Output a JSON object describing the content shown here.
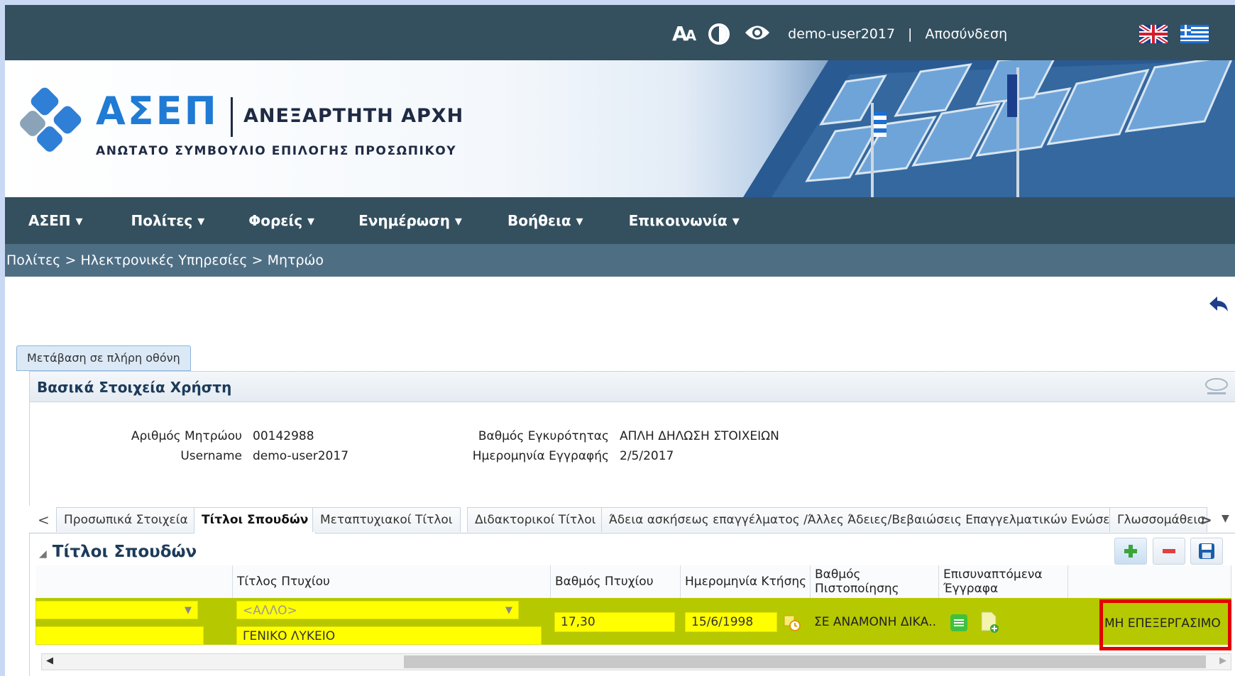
{
  "topbar": {
    "font_icon_big": "A",
    "font_icon_small": "A",
    "username": "demo-user2017",
    "separator": "|",
    "logout": "Αποσύνδεση"
  },
  "header": {
    "logo_title": "ΑΣΕΠ",
    "logo_authority": "ΑΝΕΞΑΡΤΗΤΗ ΑΡΧΗ",
    "logo_subtitle": "ΑΝΩΤΑΤΟ ΣΥΜΒΟΥΛΙΟ ΕΠΙΛΟΓΗΣ ΠΡΟΣΩΠΙΚΟΥ"
  },
  "nav": {
    "items": [
      {
        "label": "ΑΣΕΠ ▾"
      },
      {
        "label": "Πολίτες ▾"
      },
      {
        "label": "Φορείς ▾"
      },
      {
        "label": "Ενημέρωση ▾"
      },
      {
        "label": "Βοήθεια ▾"
      },
      {
        "label": "Επικοινωνία ▾"
      }
    ]
  },
  "breadcrumb": "Πολίτες > Ηλεκτρονικές Υπηρεσίες > Μητρώο",
  "fullscreen_button": "Μετάβαση σε πλήρη οθόνη",
  "user_panel": {
    "title": "Βασικά Στοιχεία Χρήστη",
    "registry_label": "Αριθμός Μητρώου",
    "registry_value": "00142988",
    "username_label": "Username",
    "username_value": "demo-user2017",
    "validity_label": "Βαθμός Εγκυρότητας",
    "validity_value": "ΑΠΛΗ ΔΗΛΩΣΗ ΣΤΟΙΧΕΙΩΝ",
    "regdate_label": "Ημερομηνία Εγγραφής",
    "regdate_value": "2/5/2017"
  },
  "tabs": {
    "items": [
      {
        "label": "Προσωπικά Στοιχεία"
      },
      {
        "label": "Τίτλοι Σπουδών"
      },
      {
        "label": "Μεταπτυχιακοί Τίτλοι"
      },
      {
        "label": "Διδακτορικοί Τίτλοι"
      },
      {
        "label": "Άδεια ασκήσεως επαγγέλματος /Άλλες Άδειες/Βεβαιώσεις Επαγγελματικών Ενώσεων"
      },
      {
        "label": "Γλωσσομάθεια"
      }
    ],
    "prev": "<",
    "next": ">",
    "menu": "▼"
  },
  "grid": {
    "title": "Τίτλοι Σπουδών",
    "collapse_icon": "◢",
    "headers": {
      "col0": "",
      "title": "Τίτλος Πτυχίου",
      "grade": "Βαθμός Πτυχίου",
      "date": "Ημερομηνία Κτήσης",
      "cert": "Βαθμός Πιστοποίησης",
      "attachments": "Επισυναπτόμενα Έγγραφα",
      "status": ""
    },
    "row": {
      "title_select": "<ΑΛΛΟ>",
      "title_text": "ΓΕΝΙΚΟ ΛΥΚΕΙΟ",
      "grade": "17,30",
      "date": "15/6/1998",
      "cert": "ΣΕ ΑΝΑΜΟΝΗ ΔΙΚΑ...",
      "status": "ΜΗ ΕΠΕΞΕΡΓΑΣΙΜΟ"
    }
  },
  "colors": {
    "topbar": "#34505f",
    "row_highlight": "#b6c800",
    "field_yellow": "#ffff00",
    "status_border": "#e00000"
  }
}
